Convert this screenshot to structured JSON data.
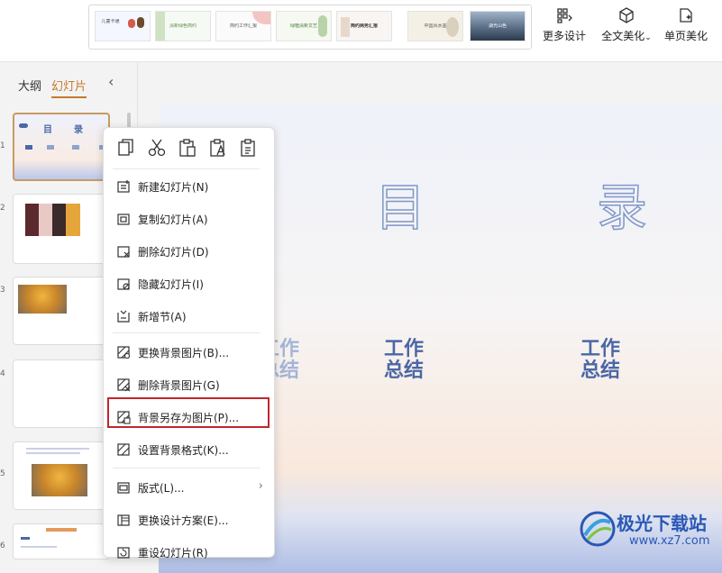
{
  "ribbon": {
    "design_thumbs": [
      {
        "label": "儿童卡通"
      },
      {
        "label": "清新绿色简约"
      },
      {
        "label": "简约工作汇报"
      },
      {
        "label": "绿植清新文艺"
      },
      {
        "label": "简约商务汇报"
      },
      {
        "label": "中国风水墨"
      },
      {
        "label": "湖光山色"
      }
    ],
    "more_design": "更多设计",
    "full_beautify": "全文美化",
    "page_beautify": "单页美化"
  },
  "left_panel": {
    "tab_outline": "大纲",
    "tab_slides": "幻灯片",
    "collapse_glyph": "‹",
    "slide_numbers": [
      "1",
      "2",
      "3",
      "4",
      "5",
      "6"
    ]
  },
  "slide": {
    "title_char_1": "目",
    "title_char_2": "录",
    "work_texts": [
      "工作\n总结",
      "工作\n总结",
      "工作\n总结"
    ]
  },
  "context_menu": {
    "items": [
      {
        "label": "新建幻灯片(N)",
        "icon": "new-slide-icon"
      },
      {
        "label": "复制幻灯片(A)",
        "icon": "copy-slide-icon"
      },
      {
        "label": "删除幻灯片(D)",
        "icon": "delete-slide-icon"
      },
      {
        "label": "隐藏幻灯片(I)",
        "icon": "hide-slide-icon"
      },
      {
        "label": "新增节(A)",
        "icon": "new-section-icon"
      },
      {
        "label": "更换背景图片(B)...",
        "icon": "change-bg-image-icon"
      },
      {
        "label": "删除背景图片(G)",
        "icon": "delete-bg-image-icon"
      },
      {
        "label": "背景另存为图片(P)...",
        "icon": "save-bg-as-image-icon"
      },
      {
        "label": "设置背景格式(K)...",
        "icon": "format-bg-icon"
      },
      {
        "label": "版式(L)...",
        "icon": "layout-icon"
      },
      {
        "label": "更换设计方案(E)...",
        "icon": "change-design-icon"
      },
      {
        "label": "重设幻灯片(R)",
        "icon": "reset-slide-icon"
      }
    ],
    "submenu_arrow": "›"
  },
  "watermark": {
    "title": "极光下载站",
    "url": "www.xz7.com"
  },
  "colors": {
    "accent": "#c47a2c",
    "highlight_red": "#c0272d",
    "slide_blue": "#4b67a6"
  }
}
